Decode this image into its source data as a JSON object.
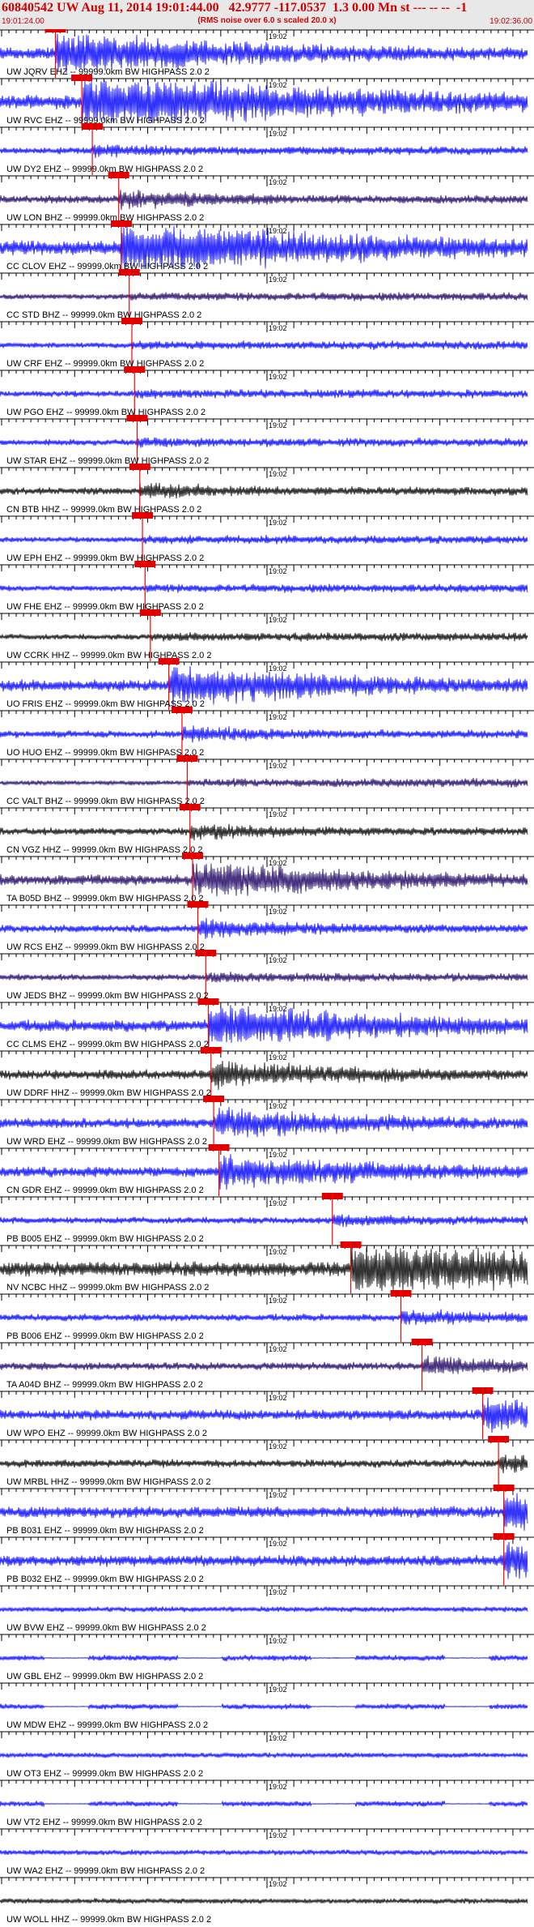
{
  "header": {
    "title": "60840542 UW Aug 11, 2014 19:01:44.00   42.9777 -117.0537  1.3 0.00 Mn st --- -- --  -1",
    "subtitle": "(RMS noise over 6.0 s scaled 20.0 x)",
    "start_time": "19:01:24.00",
    "end_time": "19:02:36.00"
  },
  "colors": {
    "pick_line": "#ff0000",
    "pick_box": "#e00000",
    "trace_blue": "#0000ff",
    "trace_navy": "#1a0060",
    "trace_black": "#000000"
  },
  "chart_data": {
    "type": "seismogram",
    "minute_tick_label": "19:02",
    "traces": [
      {
        "label": "UW JQRV EHZ -- 99999.0km BW  HIGHPASS  2.0  2",
        "color": "blue",
        "pick": 0.105,
        "amp": 0.75
      },
      {
        "label": "UW RVC EHZ -- 99999.0km BW  HIGHPASS  2.0  2",
        "color": "blue",
        "pick": 0.155,
        "amp": 1.0
      },
      {
        "label": "UW DY2 EHZ -- 99999.0km BW  HIGHPASS  2.0  2",
        "color": "blue",
        "pick": 0.175,
        "amp": 0.25
      },
      {
        "label": "UW LON BHZ -- 99999.0km BW  HIGHPASS  2.0  2",
        "color": "navy",
        "pick": 0.225,
        "amp": 0.35
      },
      {
        "label": "CC CLOV EHZ -- 99999.0km BW  HIGHPASS  2.0  2",
        "color": "blue",
        "pick": 0.23,
        "amp": 0.95
      },
      {
        "label": "CC STD BHZ -- 99999.0km BW  HIGHPASS  2.0  2",
        "color": "navy",
        "pick": 0.245,
        "amp": 0.12
      },
      {
        "label": "UW CRF EHZ -- 99999.0km BW  HIGHPASS  2.0  2",
        "color": "blue",
        "pick": 0.25,
        "amp": 0.15
      },
      {
        "label": "UW PGO EHZ -- 99999.0km BW  HIGHPASS  2.0  2",
        "color": "blue",
        "pick": 0.255,
        "amp": 0.18
      },
      {
        "label": "UW STAR EHZ -- 99999.0km BW  HIGHPASS  2.0  2",
        "color": "blue",
        "pick": 0.26,
        "amp": 0.2
      },
      {
        "label": "CN BTB HHZ -- 99999.0km BW  HIGHPASS  2.0  2",
        "color": "black",
        "pick": 0.265,
        "amp": 0.3
      },
      {
        "label": "UW EPH EHZ -- 99999.0km BW  HIGHPASS  2.0  2",
        "color": "blue",
        "pick": 0.27,
        "amp": 0.12
      },
      {
        "label": "UW FHE EHZ -- 99999.0km BW  HIGHPASS  2.0  2",
        "color": "blue",
        "pick": 0.275,
        "amp": 0.15
      },
      {
        "label": "UW CCRK HHZ -- 99999.0km BW  HIGHPASS  2.0  2",
        "color": "black",
        "pick": 0.285,
        "amp": 0.15
      },
      {
        "label": "UO FRIS EHZ -- 99999.0km BW  HIGHPASS  2.0  2",
        "color": "blue",
        "pick": 0.32,
        "amp": 0.7
      },
      {
        "label": "UO HUO EHZ -- 99999.0km BW  HIGHPASS  2.0  2",
        "color": "blue",
        "pick": 0.345,
        "amp": 0.3
      },
      {
        "label": "CC VALT BHZ -- 99999.0km BW  HIGHPASS  2.0  2",
        "color": "navy",
        "pick": 0.355,
        "amp": 0.05
      },
      {
        "label": "CN VGZ HHZ -- 99999.0km BW  HIGHPASS  2.0  2",
        "color": "black",
        "pick": 0.36,
        "amp": 0.3
      },
      {
        "label": "TA B05D BHZ -- 99999.0km BW  HIGHPASS  2.0  2",
        "color": "navy",
        "pick": 0.365,
        "amp": 0.65
      },
      {
        "label": "UW RCS EHZ -- 99999.0km BW  HIGHPASS  2.0  2",
        "color": "blue",
        "pick": 0.375,
        "amp": 0.35
      },
      {
        "label": "UW JEDS BHZ -- 99999.0km BW  HIGHPASS  2.0  2",
        "color": "navy",
        "pick": 0.39,
        "amp": 0.2
      },
      {
        "label": "CC CLMS EHZ -- 99999.0km BW  HIGHPASS  2.0  2",
        "color": "blue",
        "pick": 0.395,
        "amp": 0.75
      },
      {
        "label": "UW DDRF HHZ -- 99999.0km BW  HIGHPASS  2.0  2",
        "color": "black",
        "pick": 0.4,
        "amp": 0.5
      },
      {
        "label": "UW WRD EHZ -- 99999.0km BW  HIGHPASS  2.0  2",
        "color": "blue",
        "pick": 0.405,
        "amp": 0.55
      },
      {
        "label": "CN GDR EHZ -- 99999.0km BW  HIGHPASS  2.0  2",
        "color": "blue",
        "pick": 0.415,
        "amp": 0.6
      },
      {
        "label": "PB B005 EHZ -- 99999.0km BW  HIGHPASS  2.0  2",
        "color": "blue",
        "pick": 0.63,
        "amp": 0.25
      },
      {
        "label": "NV NCBC HHZ -- 99999.0km BW  HIGHPASS  2.0  2",
        "color": "black",
        "pick": 0.665,
        "amp": 1.0
      },
      {
        "label": "PB B006 EHZ -- 99999.0km BW  HIGHPASS  2.0  2",
        "color": "blue",
        "pick": 0.76,
        "amp": 0.3
      },
      {
        "label": "TA A04D BHZ -- 99999.0km BW  HIGHPASS  2.0  2",
        "color": "navy",
        "pick": 0.8,
        "amp": 0.35
      },
      {
        "label": "UW WPO EHZ -- 99999.0km BW  HIGHPASS  2.0  2",
        "color": "blue",
        "pick": 0.915,
        "amp": 0.6
      },
      {
        "label": "UW MRBL HHZ -- 99999.0km BW  HIGHPASS  2.0  2",
        "color": "black",
        "pick": 0.945,
        "amp": 0.35
      },
      {
        "label": "PB B031 EHZ -- 99999.0km BW  HIGHPASS  2.0  2",
        "color": "blue",
        "pick": 0.955,
        "amp": 0.7
      },
      {
        "label": "PB B032 EHZ -- 99999.0km BW  HIGHPASS  2.0  2",
        "color": "blue",
        "pick": 0.955,
        "amp": 0.65
      },
      {
        "label": "UW BVW EHZ -- 99999.0km BW  HIGHPASS  2.0  2",
        "color": "blue",
        "pick": null,
        "amp": 0.1
      },
      {
        "label": "UW GBL EHZ -- 99999.0km BW  HIGHPASS  2.0  2",
        "color": "blue",
        "pick": null,
        "amp": 0.15,
        "gappy": true
      },
      {
        "label": "UW MDW EHZ -- 99999.0km BW  HIGHPASS  2.0  2",
        "color": "blue",
        "pick": null,
        "amp": 0.12,
        "gappy": true
      },
      {
        "label": "UW OT3 EHZ -- 99999.0km BW  HIGHPASS  2.0  2",
        "color": "blue",
        "pick": null,
        "amp": 0.1
      },
      {
        "label": "UW VT2 EHZ -- 99999.0km BW  HIGHPASS  2.0  2",
        "color": "blue",
        "pick": null,
        "amp": 0.12,
        "gappy": true
      },
      {
        "label": "UW WA2 EHZ -- 99999.0km BW  HIGHPASS  2.0  2",
        "color": "blue",
        "pick": null,
        "amp": 0.1
      },
      {
        "label": "UW WOLL HHZ -- 99999.0km BW  HIGHPASS  2.0  2",
        "color": "black",
        "pick": null,
        "amp": 0.1
      }
    ]
  }
}
